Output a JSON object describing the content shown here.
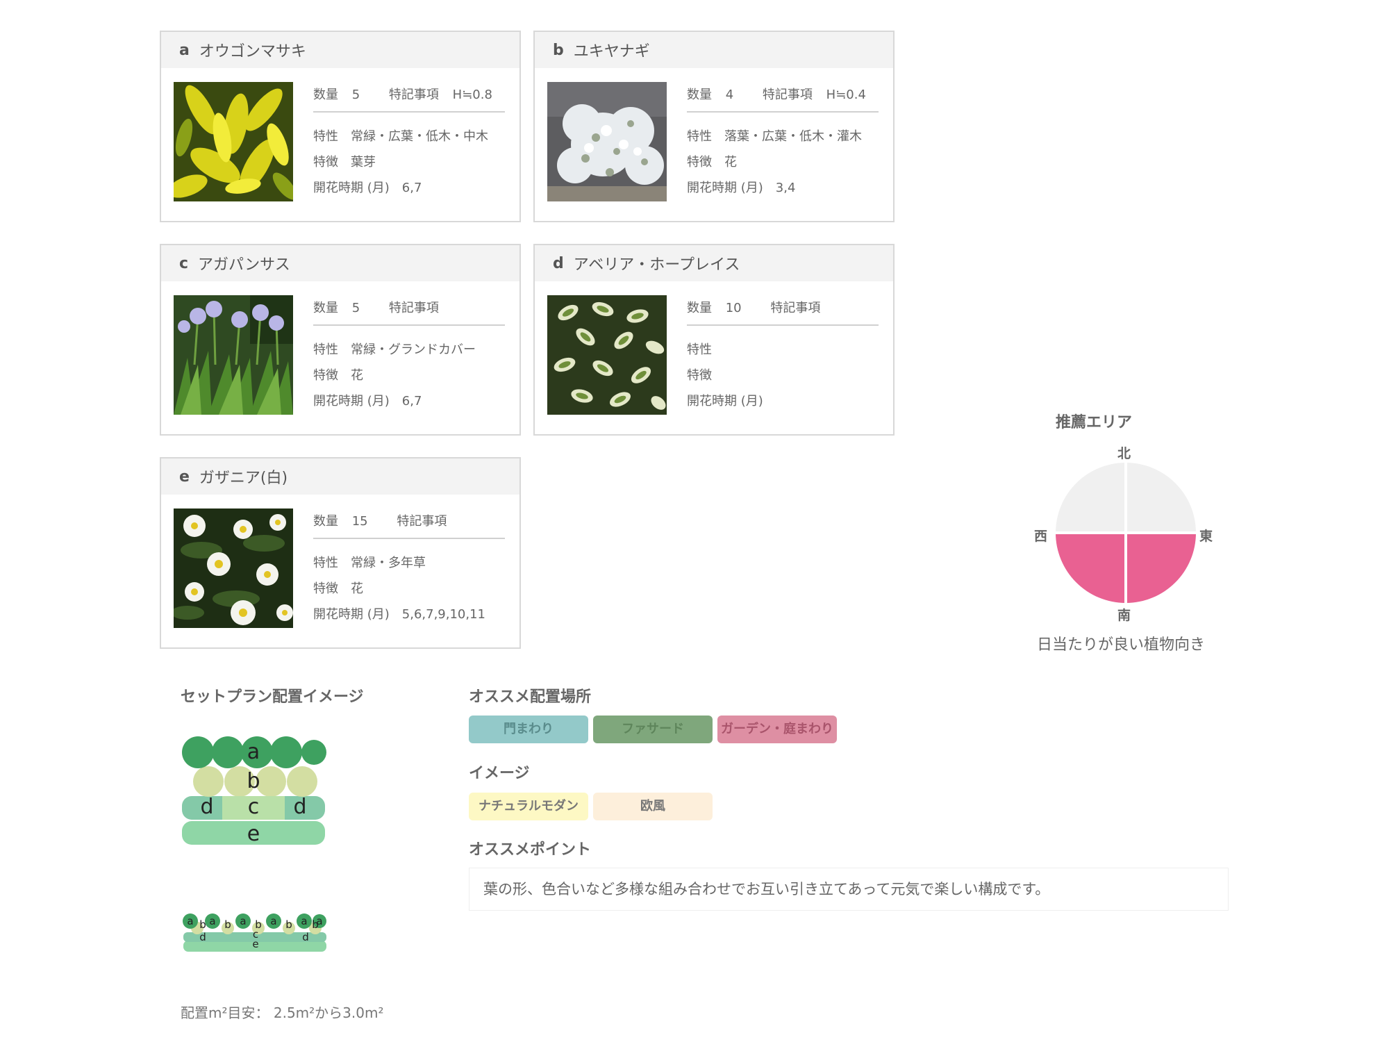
{
  "plants": [
    {
      "letter": "a",
      "name": "オウゴンマサキ",
      "qty_label": "数量",
      "qty": "5",
      "note_label": "特記事項",
      "note": "H≒0.8",
      "trait_label": "特性",
      "trait": "常緑・広葉・低木・中木",
      "feature_label": "特徴",
      "feature": "葉芽",
      "bloom_label": "開花時期 (月)",
      "bloom": "6,7"
    },
    {
      "letter": "b",
      "name": "ユキヤナギ",
      "qty_label": "数量",
      "qty": "4",
      "note_label": "特記事項",
      "note": "H≒0.4",
      "trait_label": "特性",
      "trait": "落葉・広葉・低木・灌木",
      "feature_label": "特徴",
      "feature": "花",
      "bloom_label": "開花時期 (月)",
      "bloom": "3,4"
    },
    {
      "letter": "c",
      "name": "アガパンサス",
      "qty_label": "数量",
      "qty": "5",
      "note_label": "特記事項",
      "note": "",
      "trait_label": "特性",
      "trait": "常緑・グランドカバー",
      "feature_label": "特徴",
      "feature": "花",
      "bloom_label": "開花時期 (月)",
      "bloom": "6,7"
    },
    {
      "letter": "d",
      "name": "アベリア・ホープレイス",
      "qty_label": "数量",
      "qty": "10",
      "note_label": "特記事項",
      "note": "",
      "trait_label": "特性",
      "trait": "",
      "feature_label": "特徴",
      "feature": "",
      "bloom_label": "開花時期 (月)",
      "bloom": ""
    },
    {
      "letter": "e",
      "name": "ガザニア(白)",
      "qty_label": "数量",
      "qty": "15",
      "note_label": "特記事項",
      "note": "",
      "trait_label": "特性",
      "trait": "常緑・多年草",
      "feature_label": "特徴",
      "feature": "花",
      "bloom_label": "開花時期 (月)",
      "bloom": "5,6,7,9,10,11"
    }
  ],
  "compass": {
    "title": "推薦エリア",
    "north": "北",
    "south": "南",
    "east": "東",
    "west": "西",
    "caption": "日当たりが良い植物向き",
    "recommended": [
      "south-west",
      "south-east"
    ],
    "active_color": "#e96192",
    "inactive_color": "#f0f0f0"
  },
  "plan": {
    "title": "セットプラン配置イメージ",
    "large_labels": {
      "a": "a",
      "b": "b",
      "c": "c",
      "d": "d",
      "e": "e"
    },
    "area_text": "配置m²目安： 2.5m²から3.0m²"
  },
  "placement": {
    "title": "オススメ配置場所",
    "tags": [
      {
        "label": "門まわり",
        "bg": "#93c9c9",
        "fg": "#5a8c8c"
      },
      {
        "label": "ファサード",
        "bg": "#7fa77c",
        "fg": "#5e855b"
      },
      {
        "label": "ガーデン・庭まわり",
        "bg": "#de8fa3",
        "fg": "#a9546b"
      }
    ]
  },
  "image": {
    "title": "イメージ",
    "tags": [
      {
        "label": "ナチュラルモダン",
        "bg": "#fdf8c4",
        "fg": "#777"
      },
      {
        "label": "欧風",
        "bg": "#fdefdb",
        "fg": "#777"
      }
    ]
  },
  "point": {
    "title": "オススメポイント",
    "text": "葉の形、色合いなど多様な組み合わせでお互い引き立てあって元気で楽しい構成です。"
  }
}
